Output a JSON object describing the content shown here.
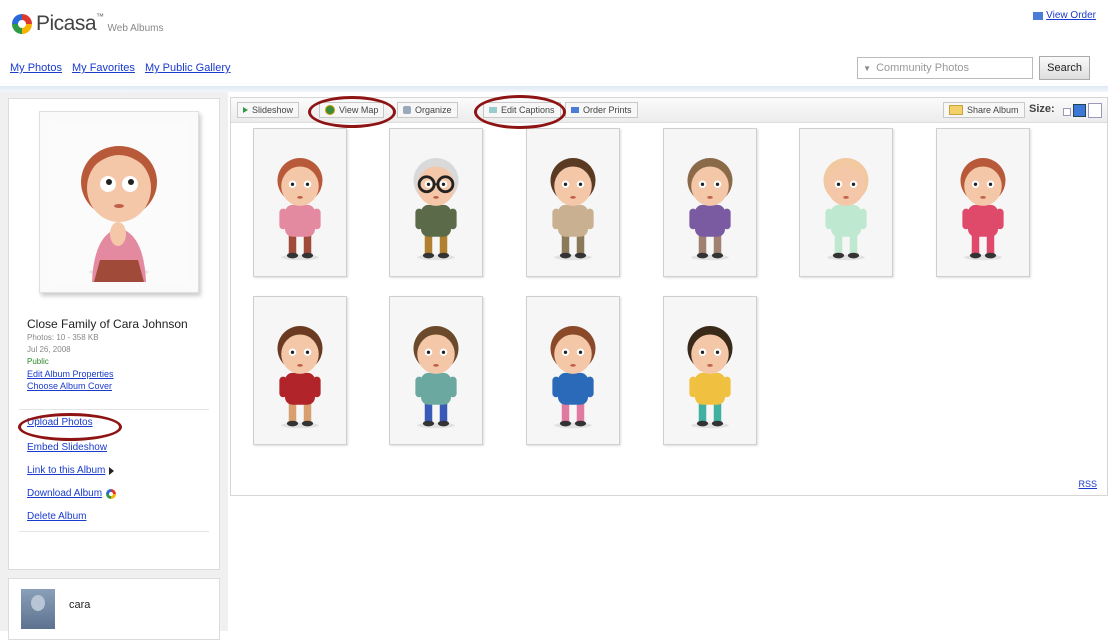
{
  "header": {
    "brand": "Picasa",
    "trademark": "™",
    "subtitle": "Web Albums",
    "view_order": "View Order"
  },
  "nav": {
    "links": [
      "My Photos",
      "My Favorites",
      "My Public Gallery"
    ]
  },
  "search": {
    "placeholder": "Community Photos",
    "button": "Search"
  },
  "album": {
    "title": "Close Family of Cara Johnson",
    "photos_meta": "Photos: 10 - 358 KB",
    "date": "Jul 26, 2008",
    "visibility": "Public",
    "edit_properties": "Edit Album Properties",
    "choose_cover": "Choose Album Cover",
    "actions": [
      "Upload Photos",
      "Embed Slideshow",
      "Link to this Album",
      "Download Album",
      "Delete Album"
    ]
  },
  "user": {
    "name": "cara"
  },
  "toolbar": {
    "slideshow": "Slideshow",
    "view_map": "View Map",
    "organize": "Organize",
    "edit_captions": "Edit Captions",
    "order_prints": "Order Prints",
    "share_album": "Share Album",
    "size_label": "Size:"
  },
  "footer": {
    "rss": "RSS"
  },
  "photos": [
    {
      "hair": "#b85a3a",
      "top": "#e48aa0",
      "bottom": "#a04a3a",
      "glasses": false
    },
    {
      "hair": "#d9d9d9",
      "top": "#5b6b4a",
      "bottom": "#b08030",
      "glasses": true
    },
    {
      "hair": "#5a3a22",
      "top": "#c8b090",
      "bottom": "#8a7a5a",
      "glasses": false
    },
    {
      "hair": "#8b6a4a",
      "top": "#7a5aa0",
      "bottom": "#a08070",
      "glasses": false
    },
    {
      "hair": "#f2c8a0",
      "top": "#bfe8d0",
      "bottom": "#bfe8d0",
      "glasses": false
    },
    {
      "hair": "#b85a3a",
      "top": "#e04a6a",
      "bottom": "#e04a6a",
      "glasses": false
    },
    {
      "hair": "#6a3a22",
      "top": "#b0242a",
      "bottom": "#d8a070",
      "glasses": false
    },
    {
      "hair": "#6a4a2a",
      "top": "#6aa8a0",
      "bottom": "#3a5ab8",
      "glasses": false
    },
    {
      "hair": "#8a4a2a",
      "top": "#2a6ab8",
      "bottom": "#e07aa0",
      "glasses": false
    },
    {
      "hair": "#3a2a1a",
      "top": "#f0c040",
      "bottom": "#40b0a0",
      "glasses": false
    }
  ],
  "colors": {
    "link": "#1a3bcc",
    "highlight_oval": "#8e1414",
    "toolbar_bg": "#ececec"
  }
}
